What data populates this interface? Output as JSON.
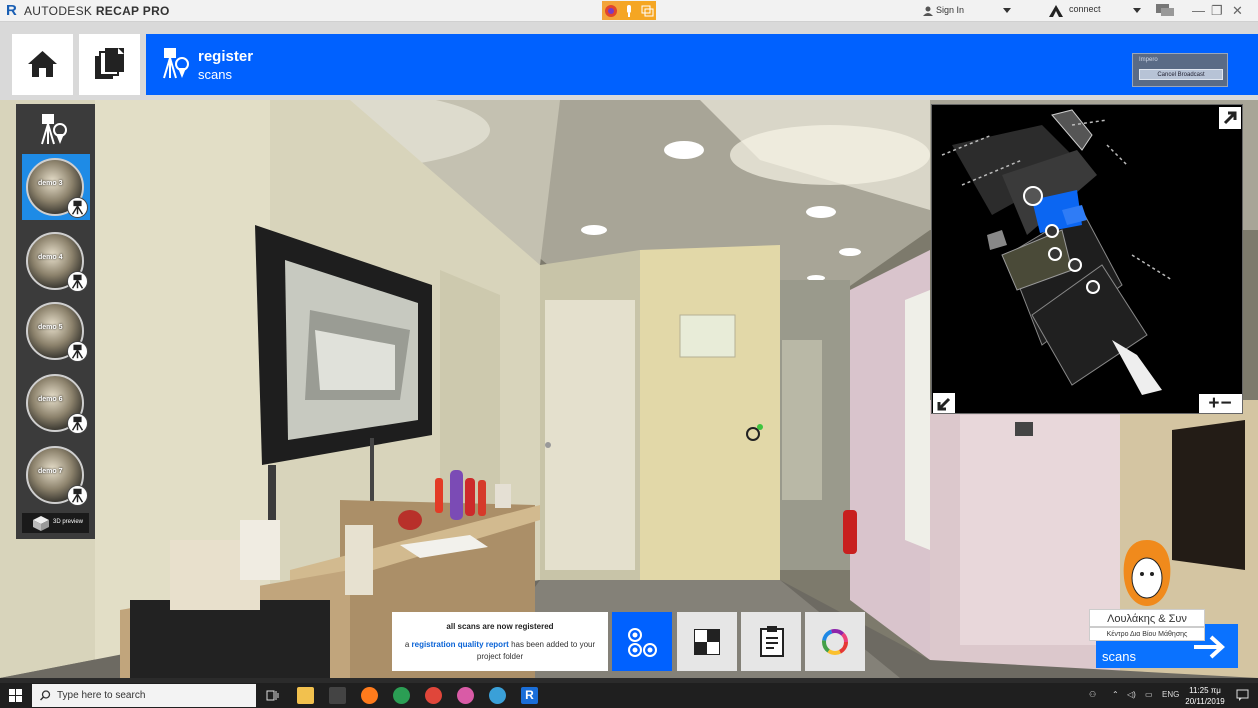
{
  "titlebar": {
    "brand": "AUTODESK",
    "product": "RECAP PRO",
    "signin_label": "Sign In",
    "connect_label": "connect"
  },
  "header": {
    "title": "register",
    "subtitle": "scans"
  },
  "broadcast": {
    "label": "Ιmpero",
    "cancel_label": "Cancel Broadcast"
  },
  "scans": [
    {
      "name": "demo 3",
      "selected": true
    },
    {
      "name": "demo 4",
      "selected": false
    },
    {
      "name": "demo 5",
      "selected": false
    },
    {
      "name": "demo 6",
      "selected": false
    },
    {
      "name": "demo 7",
      "selected": false
    }
  ],
  "preview": {
    "label": "3D preview"
  },
  "minimap": {
    "zoom_label": "+−"
  },
  "notice": {
    "headline": "all scans are now registered",
    "prefix": "a ",
    "link": "registration quality report",
    "suffix": " has been added to your project folder"
  },
  "next": {
    "label": "scans"
  },
  "watermark": {
    "name": "Λουλάκης & Συν",
    "tagline": "Κέντρο Δια Βίου Μάθησης"
  },
  "taskbar": {
    "search_placeholder": "Type here to search",
    "lang": "ENG",
    "time": "11:25 πμ",
    "date": "20/11/2019"
  },
  "colors": {
    "accent_blue": "#0061ff",
    "scan_selected": "#1e8be6"
  }
}
